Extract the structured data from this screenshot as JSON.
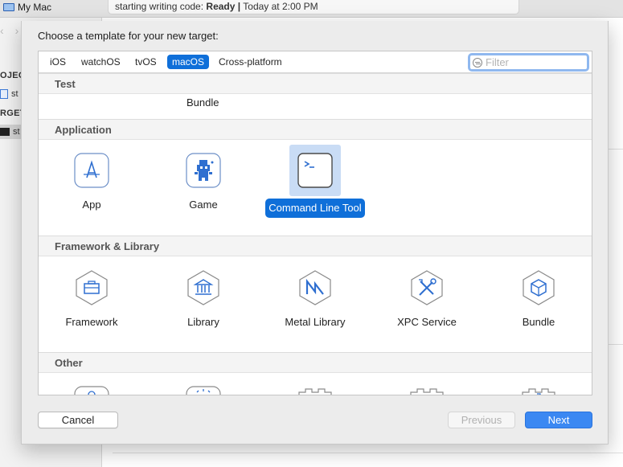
{
  "window": {
    "scheme_label": "My Mac",
    "activity_prefix": "starting writing code:",
    "activity_status": "Ready",
    "activity_sep": "|",
    "activity_time": "Today at 2:00 PM",
    "nav_back": "‹",
    "nav_forward": "›",
    "sidebar_project_header": "OJEC",
    "sidebar_targets_header": "RGET",
    "sidebar_project_item": "st",
    "sidebar_target_item": "st"
  },
  "sheet": {
    "title": "Choose a template for your new target:",
    "tabs": [
      {
        "label": "iOS",
        "active": false
      },
      {
        "label": "watchOS",
        "active": false
      },
      {
        "label": "tvOS",
        "active": false
      },
      {
        "label": "macOS",
        "active": true
      },
      {
        "label": "Cross-platform",
        "active": false
      }
    ],
    "filter_placeholder": "Filter",
    "sections": {
      "test": {
        "title": "Test",
        "partial_items": [
          "Bundle"
        ]
      },
      "application": {
        "title": "Application",
        "items": [
          {
            "label": "App",
            "icon": "app-store-a-icon",
            "selected": false
          },
          {
            "label": "Game",
            "icon": "game-sprite-icon",
            "selected": false
          },
          {
            "label": "Command Line Tool",
            "icon": "terminal-icon",
            "selected": true
          }
        ]
      },
      "framework": {
        "title": "Framework & Library",
        "items": [
          {
            "label": "Framework",
            "icon": "toolbox-icon"
          },
          {
            "label": "Library",
            "icon": "library-building-icon"
          },
          {
            "label": "Metal Library",
            "icon": "metal-m-icon"
          },
          {
            "label": "XPC Service",
            "icon": "wrench-screwdriver-icon"
          },
          {
            "label": "Bundle",
            "icon": "cube-icon"
          }
        ]
      },
      "other": {
        "title": "Other"
      }
    },
    "buttons": {
      "cancel": "Cancel",
      "previous": "Previous",
      "next": "Next"
    },
    "colors": {
      "accent": "#0f6fd9",
      "selection_bg": "#c9dcf5",
      "icon_blue": "#2f6fd0"
    }
  }
}
